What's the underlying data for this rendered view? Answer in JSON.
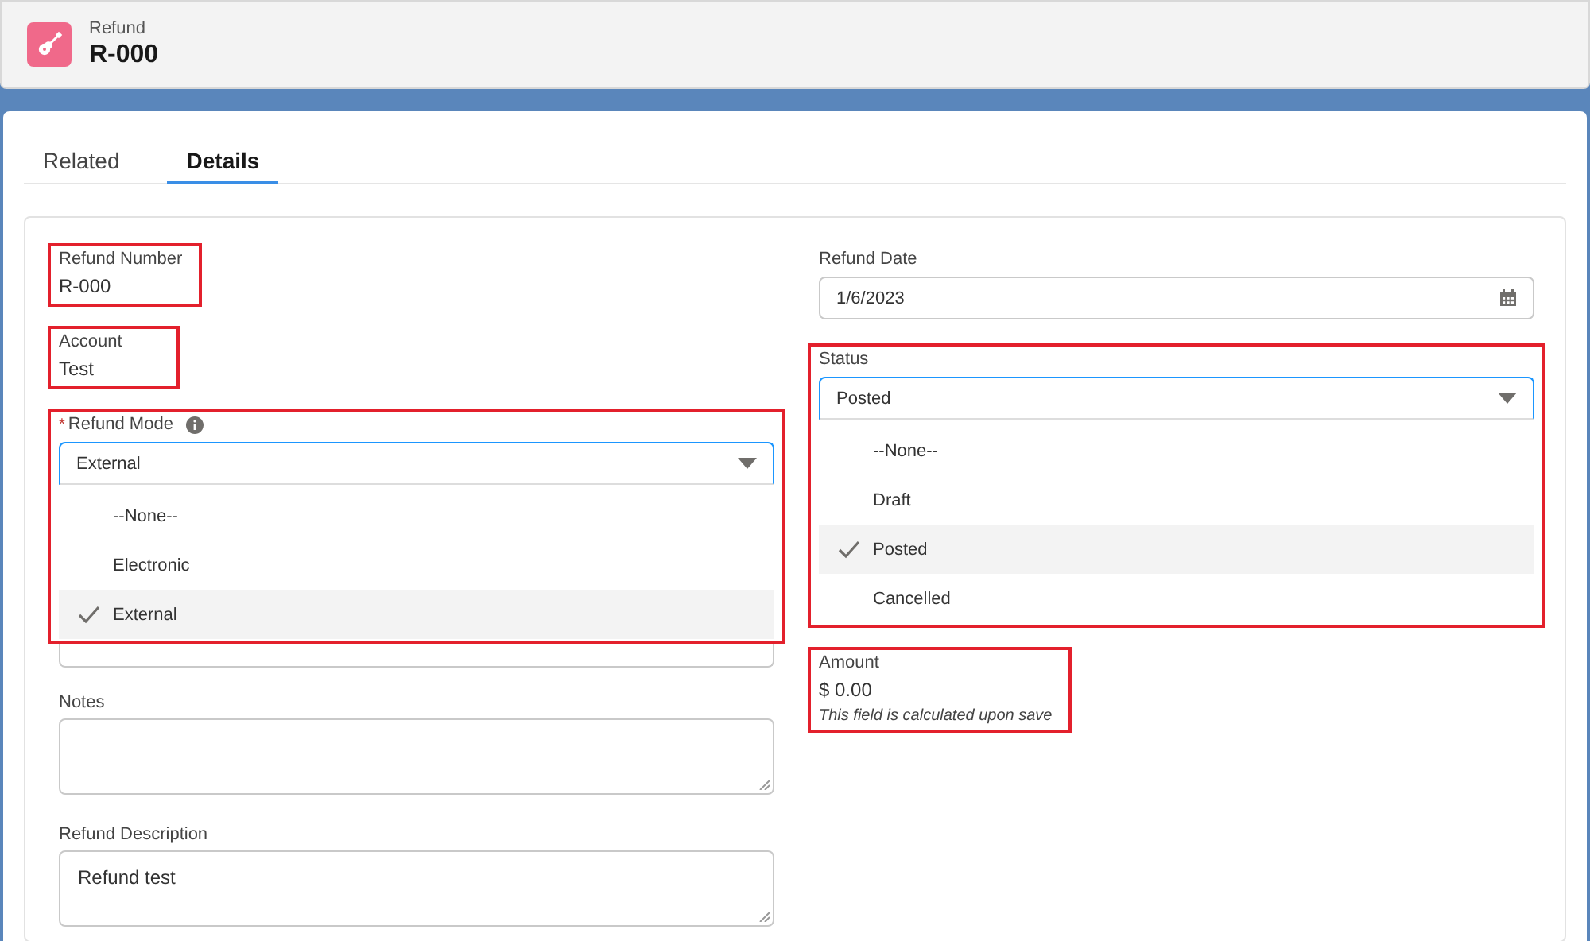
{
  "header": {
    "object_type": "Refund",
    "record_name": "R-000"
  },
  "tabs": [
    {
      "label": "Related",
      "selected": false
    },
    {
      "label": "Details",
      "selected": true
    }
  ],
  "left_fields": [
    {
      "kind": "output",
      "label": "Refund Number",
      "value": "R-000",
      "highlighted": true
    },
    {
      "kind": "output",
      "label": "Account",
      "value": "Test",
      "highlighted": true
    },
    {
      "kind": "picklist",
      "label": "Refund Mode",
      "required_mark": "*",
      "info": true,
      "value": "External",
      "highlighted": true,
      "expanded": true,
      "options": [
        {
          "label": "--None--",
          "selected": false
        },
        {
          "label": "Electronic",
          "selected": false
        },
        {
          "label": "External",
          "selected": true
        }
      ]
    },
    {
      "kind": "covered"
    },
    {
      "kind": "textarea",
      "label": "Notes"
    },
    {
      "kind": "textarea",
      "label": "Refund Description",
      "value": "Refund test"
    }
  ],
  "right_fields": [
    {
      "kind": "date",
      "label": "Refund Date",
      "value": "1/6/2023"
    },
    {
      "kind": "picklist",
      "label": "Status",
      "value": "Posted",
      "highlighted": true,
      "expanded": true,
      "options": [
        {
          "label": "--None--",
          "selected": false
        },
        {
          "label": "Draft",
          "selected": false
        },
        {
          "label": "Posted",
          "selected": true
        },
        {
          "label": "Cancelled",
          "selected": false
        }
      ]
    },
    {
      "kind": "output",
      "label": "Amount",
      "value": "$ 0.00",
      "hint": "This field is calculated upon save",
      "highlighted": true
    }
  ]
}
